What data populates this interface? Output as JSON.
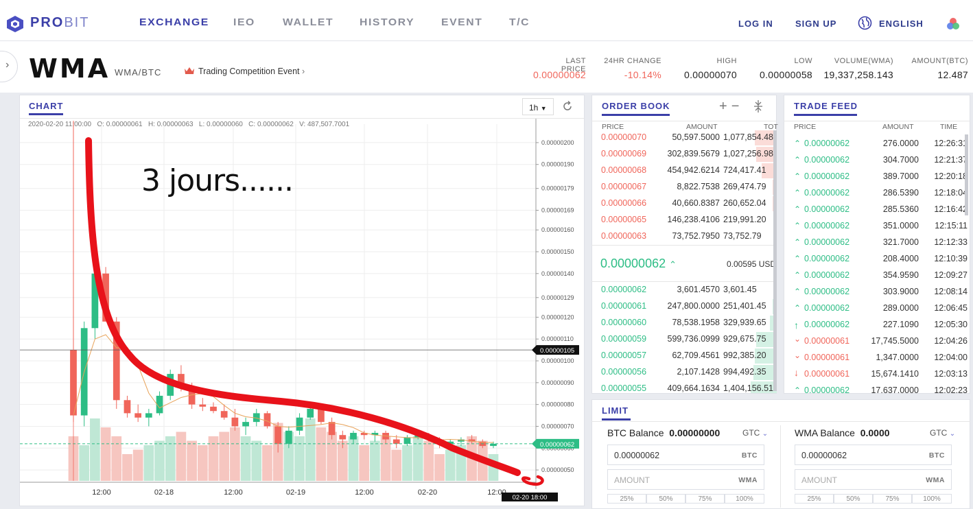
{
  "brand": {
    "name_a": "PRO",
    "name_b": "BIT"
  },
  "nav": {
    "items": [
      "EXCHANGE",
      "IEO",
      "WALLET",
      "HISTORY",
      "EVENT",
      "T/C"
    ],
    "login": "LOG IN",
    "signup": "SIGN UP",
    "language": "ENGLISH"
  },
  "market": {
    "symbol": "WMA",
    "pair": "WMA/BTC",
    "event": "Trading Competition Event"
  },
  "stats": [
    {
      "label": "LAST PRICE",
      "value": "0.00000062",
      "color": "#f0655a"
    },
    {
      "label": "24HR CHANGE",
      "value": "-10.14%",
      "color": "#f0655a"
    },
    {
      "label": "HIGH",
      "value": "0.00000070",
      "color": "#222"
    },
    {
      "label": "LOW",
      "value": "0.00000058",
      "color": "#222"
    },
    {
      "label": "VOLUME(WMA)",
      "value": "19,337,258.143",
      "color": "#222"
    },
    {
      "label": "AMOUNT(BTC)",
      "value": "12.487",
      "color": "#222"
    }
  ],
  "chart": {
    "tab": "CHART",
    "interval": "1h",
    "ohlc": "2020-02-20 11:00:00   O: 0.00000061   H: 0.00000063   L: 0.00000060   C: 0.00000062   V: 487,507.7001",
    "annotation": "3 jours......",
    "cursor_price": "0.00000105",
    "current_price": "0.00000062",
    "cursor_time": "02-20 18:00",
    "y_ticks": [
      "0.00000200",
      "0.00000190",
      "0.00000179",
      "0.00000169",
      "0.00000160",
      "0.00000150",
      "0.00000140",
      "0.00000129",
      "0.00000120",
      "0.00000110",
      "0.00000100",
      "0.00000090",
      "0.00000080",
      "0.00000070",
      "0.00000060",
      "0.00000050"
    ],
    "x_ticks": [
      "12:00",
      "02-18",
      "12:00",
      "02-19",
      "12:00",
      "02-20",
      "12:00"
    ]
  },
  "chart_data": {
    "type": "candlestick",
    "series": [
      {
        "values": [
          [
            1.05e-06,
            2.1e-06,
            7.2e-07,
            7.5e-07
          ],
          [
            7.5e-07,
            1.18e-06,
            7e-07,
            1.15e-06
          ],
          [
            1.15e-06,
            1.46e-06,
            1.1e-06,
            1.4e-06
          ],
          [
            1.4e-06,
            1.43e-06,
            1.18e-06,
            1.18e-06
          ],
          [
            1.18e-06,
            1.2e-06,
            7.8e-07,
            8.2e-07
          ],
          [
            8.2e-07,
            8.4e-07,
            7.4e-07,
            7.6e-07
          ],
          [
            7.6e-07,
            8e-07,
            7.2e-07,
            7.4e-07
          ],
          [
            7.4e-07,
            7.8e-07,
            7e-07,
            7.6e-07
          ],
          [
            7.6e-07,
            8.6e-07,
            7.5e-07,
            8.4e-07
          ],
          [
            8.4e-07,
            9.6e-07,
            8.2e-07,
            9.4e-07
          ],
          [
            9.4e-07,
            9.8e-07,
            8.6e-07,
            8.8e-07
          ],
          [
            8.8e-07,
            9e-07,
            7.8e-07,
            8e-07
          ],
          [
            8e-07,
            8.3e-07,
            7.7e-07,
            7.9e-07
          ],
          [
            7.9e-07,
            8.1e-07,
            7.6e-07,
            7.7e-07
          ],
          [
            7.7e-07,
            8e-07,
            7.3e-07,
            7.4e-07
          ],
          [
            7.4e-07,
            7.8e-07,
            6.8e-07,
            7e-07
          ],
          [
            7e-07,
            7.4e-07,
            6.6e-07,
            7.2e-07
          ],
          [
            7.2e-07,
            7.8e-07,
            7e-07,
            7.6e-07
          ],
          [
            7.6e-07,
            7.7e-07,
            6.9e-07,
            7e-07
          ],
          [
            7e-07,
            7.2e-07,
            5.8e-07,
            6.2e-07
          ],
          [
            6.2e-07,
            7e-07,
            6e-07,
            6.8e-07
          ],
          [
            6.8e-07,
            7.6e-07,
            6.6e-07,
            7.4e-07
          ],
          [
            7.4e-07,
            8e-07,
            7.3e-07,
            7.8e-07
          ],
          [
            7.8e-07,
            7.9e-07,
            7.1e-07,
            7.2e-07
          ],
          [
            7.2e-07,
            7.4e-07,
            6.4e-07,
            6.6e-07
          ],
          [
            6.6e-07,
            6.8e-07,
            6e-07,
            6.4e-07
          ],
          [
            6.4e-07,
            6.8e-07,
            6.2e-07,
            6.7e-07
          ],
          [
            6.7e-07,
            6.8e-07,
            6.4e-07,
            6.6e-07
          ],
          [
            6.6e-07,
            6.8e-07,
            6.3e-07,
            6.7e-07
          ],
          [
            6.7e-07,
            6.8e-07,
            6.2e-07,
            6.4e-07
          ],
          [
            6.4e-07,
            6.6e-07,
            6e-07,
            6.2e-07
          ],
          [
            6.2e-07,
            6.6e-07,
            6.1e-07,
            6.5e-07
          ],
          [
            6.5e-07,
            6.7e-07,
            6.4e-07,
            6.6e-07
          ],
          [
            6.6e-07,
            6.7e-07,
            6.3e-07,
            6.4e-07
          ],
          [
            6.4e-07,
            6.5e-07,
            6e-07,
            6.2e-07
          ],
          [
            6.2e-07,
            6.4e-07,
            6e-07,
            6.3e-07
          ],
          [
            6.3e-07,
            6.5e-07,
            6.1e-07,
            6.4e-07
          ],
          [
            6.4e-07,
            6.6e-07,
            6.2e-07,
            6.3e-07
          ],
          [
            6.3e-07,
            6.4e-07,
            6e-07,
            6.1e-07
          ],
          [
            6.1e-07,
            6.3e-07,
            6e-07,
            6.2e-07
          ]
        ]
      }
    ],
    "volumes": [
      0.5,
      0.4,
      0.7,
      0.6,
      0.5,
      0.3,
      0.35,
      0.4,
      0.45,
      0.5,
      0.55,
      0.45,
      0.4,
      0.5,
      0.55,
      0.6,
      0.5,
      0.45,
      0.4,
      0.65,
      0.55,
      0.5,
      0.7,
      0.6,
      0.55,
      0.45,
      0.5,
      0.4,
      0.45,
      0.5,
      0.35,
      0.4,
      0.5,
      0.45,
      0.3,
      0.35,
      0.4,
      0.5,
      0.45,
      0.3
    ],
    "ylim": [
      4.5e-07,
      2.05e-06
    ]
  },
  "orderbook": {
    "title": "ORDER BOOK",
    "headers": [
      "PRICE",
      "AMOUNT",
      "TOT"
    ],
    "asks": [
      [
        "0.00000070",
        "50,597.5000",
        "1,077,854.48",
        0.85
      ],
      [
        "0.00000069",
        "302,839.5679",
        "1,027,256.98",
        0.8
      ],
      [
        "0.00000068",
        "454,942.6214",
        "724,417.41",
        0.6
      ],
      [
        "0.00000067",
        "8,822.7538",
        "269,474.79",
        0.2
      ],
      [
        "0.00000066",
        "40,660.8387",
        "260,652.04",
        0.2
      ],
      [
        "0.00000065",
        "146,238.4106",
        "219,991.20",
        0.15
      ],
      [
        "0.00000063",
        "73,752.7950",
        "73,752.79",
        0.05
      ]
    ],
    "mid_price": "0.00000062",
    "mid_usd": "0.00595 USD",
    "bids": [
      [
        "0.00000062",
        "3,601.4570",
        "3,601.45",
        0.01
      ],
      [
        "0.00000061",
        "247,800.0000",
        "251,401.45",
        0.2
      ],
      [
        "0.00000060",
        "78,538.1958",
        "329,939.65",
        0.3
      ],
      [
        "0.00000059",
        "599,736.0999",
        "929,675.75",
        0.8
      ],
      [
        "0.00000057",
        "62,709.4561",
        "992,385.20",
        0.85
      ],
      [
        "0.00000056",
        "2,107.1428",
        "994,492.35",
        0.9
      ],
      [
        "0.00000055",
        "409,664.1634",
        "1,404,156.51",
        1.0
      ]
    ]
  },
  "tradefeed": {
    "title": "TRADE FEED",
    "headers": [
      "PRICE",
      "AMOUNT",
      "TIME"
    ],
    "rows": [
      [
        "0.00000062",
        "276.0000",
        "12:26:31",
        "up"
      ],
      [
        "0.00000062",
        "304.7000",
        "12:21:37",
        "up"
      ],
      [
        "0.00000062",
        "389.7000",
        "12:20:18",
        "up"
      ],
      [
        "0.00000062",
        "286.5390",
        "12:18:04",
        "up"
      ],
      [
        "0.00000062",
        "285.5360",
        "12:16:42",
        "up"
      ],
      [
        "0.00000062",
        "351.0000",
        "12:15:11",
        "up"
      ],
      [
        "0.00000062",
        "321.7000",
        "12:12:33",
        "up"
      ],
      [
        "0.00000062",
        "208.4000",
        "12:10:39",
        "up"
      ],
      [
        "0.00000062",
        "354.9590",
        "12:09:27",
        "up"
      ],
      [
        "0.00000062",
        "303.9000",
        "12:08:14",
        "up"
      ],
      [
        "0.00000062",
        "289.0000",
        "12:06:45",
        "up"
      ],
      [
        "0.00000062",
        "227.1090",
        "12:05:30",
        "up-bold"
      ],
      [
        "0.00000061",
        "17,745.5000",
        "12:04:26",
        "down"
      ],
      [
        "0.00000061",
        "1,347.0000",
        "12:04:00",
        "down"
      ],
      [
        "0.00000061",
        "15,674.1410",
        "12:03:13",
        "down-bold"
      ],
      [
        "0.00000062",
        "17,637.0000",
        "12:02:23",
        "up"
      ]
    ]
  },
  "limit": {
    "title": "LIMIT",
    "btc": {
      "label": "BTC Balance",
      "value": "0.00000000",
      "unit": "GTC",
      "price": "0.00000062",
      "price_unit": "BTC",
      "amount": "AMOUNT",
      "amount_unit": "WMA"
    },
    "wma": {
      "label": "WMA Balance",
      "value": "0.0000",
      "unit": "GTC",
      "price": "0.00000062",
      "price_unit": "BTC",
      "amount": "AMOUNT",
      "amount_unit": "WMA"
    },
    "pcts": [
      "25%",
      "50%",
      "75%",
      "100%"
    ]
  },
  "colors": {
    "up": "#2dbd85",
    "down": "#f0655a",
    "accent": "#3b3fa8",
    "red_ink": "#e8121a"
  }
}
